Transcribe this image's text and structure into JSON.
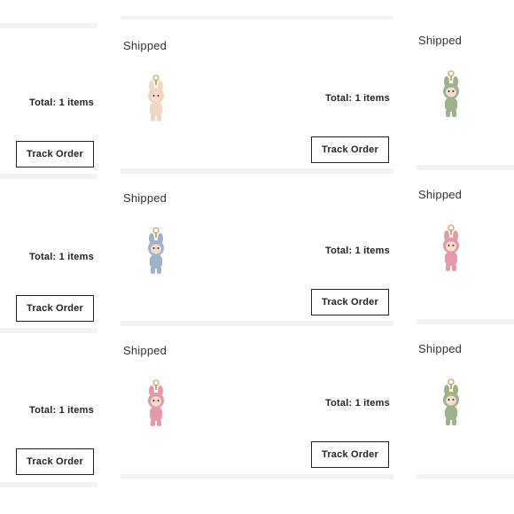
{
  "orders": [
    {
      "status": "",
      "total": "Total: 1 items",
      "track_label": "Track Order",
      "figure_color": ""
    },
    {
      "status": "Shipped",
      "total": "Total: 1 items",
      "track_label": "Track Order",
      "figure_color": "#f2d5c0"
    },
    {
      "status": "Shipped",
      "total": "",
      "track_label": "",
      "figure_color": "#9cb28a"
    },
    {
      "status": "",
      "total": "Total: 1 items",
      "track_label": "Track Order",
      "figure_color": ""
    },
    {
      "status": "Shipped",
      "total": "Total: 1 items",
      "track_label": "Track Order",
      "figure_color": "#9fb2cc"
    },
    {
      "status": "Shipped",
      "total": "",
      "track_label": "",
      "figure_color": "#e39aa8"
    },
    {
      "status": "",
      "total": "Total: 1 items",
      "track_label": "Track Order",
      "figure_color": ""
    },
    {
      "status": "Shipped",
      "total": "Total: 1 items",
      "track_label": "Track Order",
      "figure_color": "#e39aa8"
    },
    {
      "status": "Shipped",
      "total": "",
      "track_label": "",
      "figure_color": "#9cb28a"
    }
  ]
}
